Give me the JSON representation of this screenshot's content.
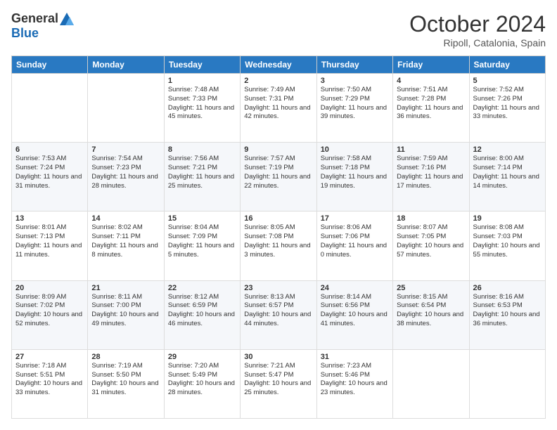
{
  "logo": {
    "general": "General",
    "blue": "Blue"
  },
  "header": {
    "month": "October 2024",
    "location": "Ripoll, Catalonia, Spain"
  },
  "weekdays": [
    "Sunday",
    "Monday",
    "Tuesday",
    "Wednesday",
    "Thursday",
    "Friday",
    "Saturday"
  ],
  "weeks": [
    [
      null,
      null,
      {
        "day": "1",
        "sunrise": "7:48 AM",
        "sunset": "7:33 PM",
        "daylight": "11 hours and 45 minutes."
      },
      {
        "day": "2",
        "sunrise": "7:49 AM",
        "sunset": "7:31 PM",
        "daylight": "11 hours and 42 minutes."
      },
      {
        "day": "3",
        "sunrise": "7:50 AM",
        "sunset": "7:29 PM",
        "daylight": "11 hours and 39 minutes."
      },
      {
        "day": "4",
        "sunrise": "7:51 AM",
        "sunset": "7:28 PM",
        "daylight": "11 hours and 36 minutes."
      },
      {
        "day": "5",
        "sunrise": "7:52 AM",
        "sunset": "7:26 PM",
        "daylight": "11 hours and 33 minutes."
      }
    ],
    [
      {
        "day": "6",
        "sunrise": "7:53 AM",
        "sunset": "7:24 PM",
        "daylight": "11 hours and 31 minutes."
      },
      {
        "day": "7",
        "sunrise": "7:54 AM",
        "sunset": "7:23 PM",
        "daylight": "11 hours and 28 minutes."
      },
      {
        "day": "8",
        "sunrise": "7:56 AM",
        "sunset": "7:21 PM",
        "daylight": "11 hours and 25 minutes."
      },
      {
        "day": "9",
        "sunrise": "7:57 AM",
        "sunset": "7:19 PM",
        "daylight": "11 hours and 22 minutes."
      },
      {
        "day": "10",
        "sunrise": "7:58 AM",
        "sunset": "7:18 PM",
        "daylight": "11 hours and 19 minutes."
      },
      {
        "day": "11",
        "sunrise": "7:59 AM",
        "sunset": "7:16 PM",
        "daylight": "11 hours and 17 minutes."
      },
      {
        "day": "12",
        "sunrise": "8:00 AM",
        "sunset": "7:14 PM",
        "daylight": "11 hours and 14 minutes."
      }
    ],
    [
      {
        "day": "13",
        "sunrise": "8:01 AM",
        "sunset": "7:13 PM",
        "daylight": "11 hours and 11 minutes."
      },
      {
        "day": "14",
        "sunrise": "8:02 AM",
        "sunset": "7:11 PM",
        "daylight": "11 hours and 8 minutes."
      },
      {
        "day": "15",
        "sunrise": "8:04 AM",
        "sunset": "7:09 PM",
        "daylight": "11 hours and 5 minutes."
      },
      {
        "day": "16",
        "sunrise": "8:05 AM",
        "sunset": "7:08 PM",
        "daylight": "11 hours and 3 minutes."
      },
      {
        "day": "17",
        "sunrise": "8:06 AM",
        "sunset": "7:06 PM",
        "daylight": "11 hours and 0 minutes."
      },
      {
        "day": "18",
        "sunrise": "8:07 AM",
        "sunset": "7:05 PM",
        "daylight": "10 hours and 57 minutes."
      },
      {
        "day": "19",
        "sunrise": "8:08 AM",
        "sunset": "7:03 PM",
        "daylight": "10 hours and 55 minutes."
      }
    ],
    [
      {
        "day": "20",
        "sunrise": "8:09 AM",
        "sunset": "7:02 PM",
        "daylight": "10 hours and 52 minutes."
      },
      {
        "day": "21",
        "sunrise": "8:11 AM",
        "sunset": "7:00 PM",
        "daylight": "10 hours and 49 minutes."
      },
      {
        "day": "22",
        "sunrise": "8:12 AM",
        "sunset": "6:59 PM",
        "daylight": "10 hours and 46 minutes."
      },
      {
        "day": "23",
        "sunrise": "8:13 AM",
        "sunset": "6:57 PM",
        "daylight": "10 hours and 44 minutes."
      },
      {
        "day": "24",
        "sunrise": "8:14 AM",
        "sunset": "6:56 PM",
        "daylight": "10 hours and 41 minutes."
      },
      {
        "day": "25",
        "sunrise": "8:15 AM",
        "sunset": "6:54 PM",
        "daylight": "10 hours and 38 minutes."
      },
      {
        "day": "26",
        "sunrise": "8:16 AM",
        "sunset": "6:53 PM",
        "daylight": "10 hours and 36 minutes."
      }
    ],
    [
      {
        "day": "27",
        "sunrise": "7:18 AM",
        "sunset": "5:51 PM",
        "daylight": "10 hours and 33 minutes."
      },
      {
        "day": "28",
        "sunrise": "7:19 AM",
        "sunset": "5:50 PM",
        "daylight": "10 hours and 31 minutes."
      },
      {
        "day": "29",
        "sunrise": "7:20 AM",
        "sunset": "5:49 PM",
        "daylight": "10 hours and 28 minutes."
      },
      {
        "day": "30",
        "sunrise": "7:21 AM",
        "sunset": "5:47 PM",
        "daylight": "10 hours and 25 minutes."
      },
      {
        "day": "31",
        "sunrise": "7:23 AM",
        "sunset": "5:46 PM",
        "daylight": "10 hours and 23 minutes."
      },
      null,
      null
    ]
  ]
}
